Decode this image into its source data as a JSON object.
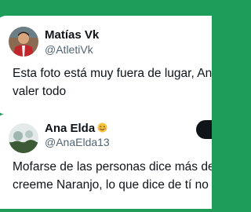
{
  "posts": [
    {
      "display_name": "Matías Vk",
      "handle": "@AtletiVk",
      "lines": [
        "Esta foto está muy fuera de lugar, Anton",
        "valer todo"
      ]
    },
    {
      "display_name": "Ana Elda",
      "name_emoji": "smiling-face-emoji",
      "handle": "@AnaElda13",
      "lines": [
        "Mofarse de las personas dice más de tí, qu",
        "creeme Naranjo, lo que dice de tí no es bu"
      ]
    }
  ],
  "colors": {
    "background": "#1e9c5a",
    "card": "#ffffff",
    "text": "#0f1419",
    "muted": "#536471"
  }
}
